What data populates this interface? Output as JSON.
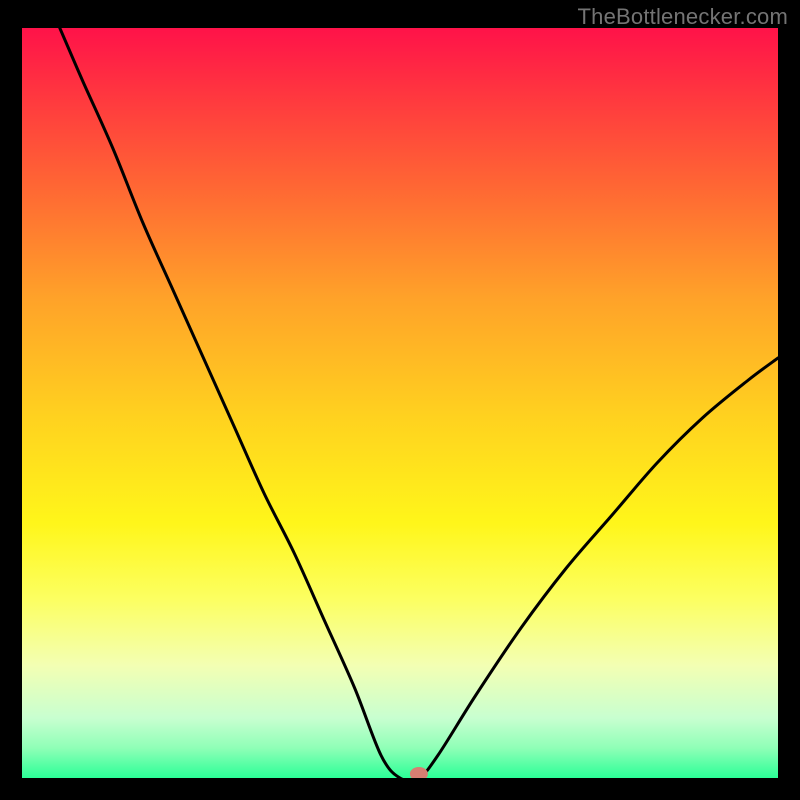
{
  "watermark": "TheBottlenecker.com",
  "chart_data": {
    "type": "line",
    "title": "",
    "xlabel": "",
    "ylabel": "",
    "x": [
      0.05,
      0.08,
      0.12,
      0.16,
      0.2,
      0.24,
      0.28,
      0.32,
      0.36,
      0.4,
      0.44,
      0.475,
      0.5,
      0.525,
      0.55,
      0.6,
      0.66,
      0.72,
      0.78,
      0.84,
      0.9,
      0.96,
      1.0
    ],
    "y": [
      1.0,
      0.93,
      0.84,
      0.74,
      0.65,
      0.56,
      0.47,
      0.38,
      0.3,
      0.21,
      0.12,
      0.03,
      0.0,
      0.0,
      0.03,
      0.11,
      0.2,
      0.28,
      0.35,
      0.42,
      0.48,
      0.53,
      0.56
    ],
    "xlim": [
      0,
      1
    ],
    "ylim": [
      0,
      1
    ],
    "marker": {
      "x": 0.525,
      "y": 0.0
    },
    "gradient_stops": [
      {
        "pos": 0.0,
        "color": "#ff1249"
      },
      {
        "pos": 0.1,
        "color": "#ff3b3e"
      },
      {
        "pos": 0.22,
        "color": "#ff6a33"
      },
      {
        "pos": 0.36,
        "color": "#ffa229"
      },
      {
        "pos": 0.52,
        "color": "#ffd21f"
      },
      {
        "pos": 0.66,
        "color": "#fff61a"
      },
      {
        "pos": 0.76,
        "color": "#fcff60"
      },
      {
        "pos": 0.85,
        "color": "#f3ffb3"
      },
      {
        "pos": 0.92,
        "color": "#c8ffd0"
      },
      {
        "pos": 0.96,
        "color": "#8fffb7"
      },
      {
        "pos": 1.0,
        "color": "#2bff97"
      }
    ]
  }
}
